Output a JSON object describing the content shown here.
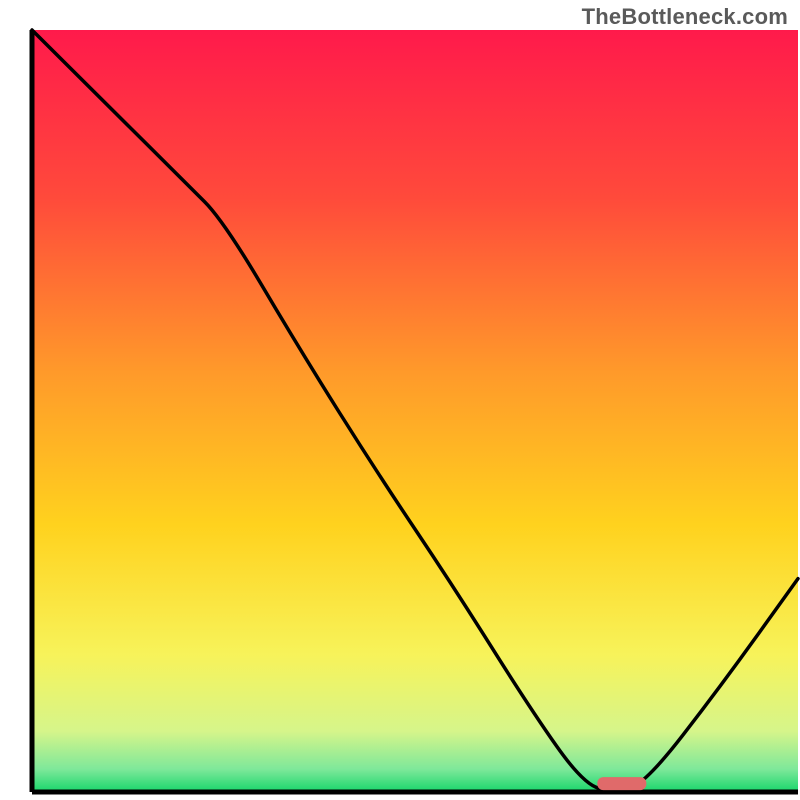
{
  "watermark": "TheBottleneck.com",
  "chart_data": {
    "type": "line",
    "title": "",
    "xlabel": "",
    "ylabel": "",
    "xlim": [
      0,
      100
    ],
    "ylim": [
      0,
      100
    ],
    "grid": false,
    "legend": false,
    "background_gradient": [
      {
        "stop": 0.0,
        "color": "#ff1a4b"
      },
      {
        "stop": 0.22,
        "color": "#ff4a3b"
      },
      {
        "stop": 0.45,
        "color": "#ff9a2a"
      },
      {
        "stop": 0.65,
        "color": "#ffd21e"
      },
      {
        "stop": 0.82,
        "color": "#f7f35a"
      },
      {
        "stop": 0.92,
        "color": "#d6f58a"
      },
      {
        "stop": 0.97,
        "color": "#7ee89a"
      },
      {
        "stop": 1.0,
        "color": "#18d66b"
      }
    ],
    "curve": [
      {
        "x": 0,
        "y": 100
      },
      {
        "x": 10,
        "y": 90
      },
      {
        "x": 20,
        "y": 80
      },
      {
        "x": 25,
        "y": 75
      },
      {
        "x": 35,
        "y": 58
      },
      {
        "x": 45,
        "y": 42
      },
      {
        "x": 55,
        "y": 27
      },
      {
        "x": 65,
        "y": 11
      },
      {
        "x": 72,
        "y": 1
      },
      {
        "x": 76,
        "y": 0
      },
      {
        "x": 80,
        "y": 1
      },
      {
        "x": 90,
        "y": 14
      },
      {
        "x": 100,
        "y": 28
      }
    ],
    "marker": {
      "x_center": 77,
      "x_halfwidth": 3.2,
      "y": 1.1,
      "color": "#e06a6a",
      "shape": "pill"
    }
  }
}
